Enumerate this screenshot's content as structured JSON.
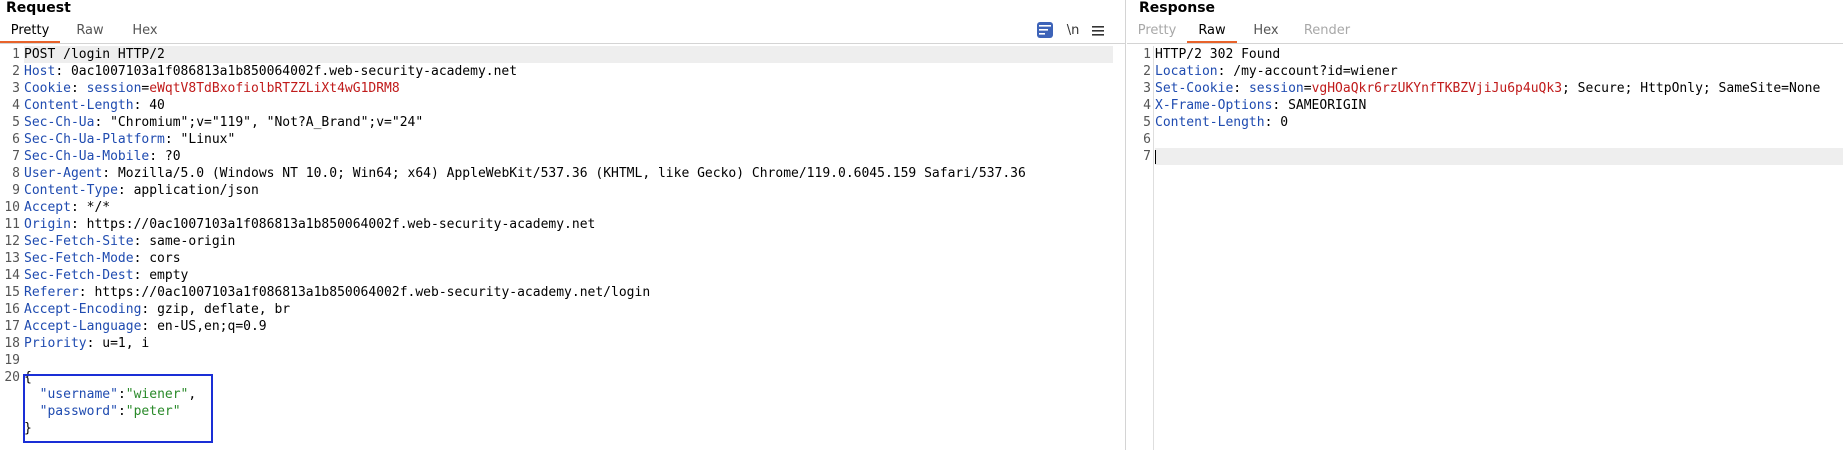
{
  "request": {
    "title": "Request",
    "tabs": [
      "Pretty",
      "Raw",
      "Hex"
    ],
    "active_tab": "Pretty",
    "tools": {
      "wrap_icon": "wrap-lines-icon",
      "newline_label": "\\n",
      "menu_icon": "hamburger-menu-icon"
    },
    "lines": [
      {
        "num": "1",
        "raw": "POST /login HTTP/2"
      },
      {
        "num": "2",
        "key": "Host",
        "value": "0ac1007103a1f086813a1b850064002f.web-security-academy.net"
      },
      {
        "num": "3",
        "key": "Cookie",
        "ckey": "session",
        "cval": "eWqtV8TdBxofiolbRTZZLiXt4wG1DRM8"
      },
      {
        "num": "4",
        "key": "Content-Length",
        "value": "40"
      },
      {
        "num": "5",
        "key": "Sec-Ch-Ua",
        "value": "\"Chromium\";v=\"119\", \"Not?A_Brand\";v=\"24\""
      },
      {
        "num": "6",
        "key": "Sec-Ch-Ua-Platform",
        "value": "\"Linux\""
      },
      {
        "num": "7",
        "key": "Sec-Ch-Ua-Mobile",
        "value": "?0"
      },
      {
        "num": "8",
        "key": "User-Agent",
        "value": "Mozilla/5.0 (Windows NT 10.0; Win64; x64) AppleWebKit/537.36 (KHTML, like Gecko) Chrome/119.0.6045.159 Safari/537.36"
      },
      {
        "num": "9",
        "key": "Content-Type",
        "value": "application/json"
      },
      {
        "num": "10",
        "key": "Accept",
        "value": "*/*"
      },
      {
        "num": "11",
        "key": "Origin",
        "value": "https://0ac1007103a1f086813a1b850064002f.web-security-academy.net"
      },
      {
        "num": "12",
        "key": "Sec-Fetch-Site",
        "value": "same-origin"
      },
      {
        "num": "13",
        "key": "Sec-Fetch-Mode",
        "value": "cors"
      },
      {
        "num": "14",
        "key": "Sec-Fetch-Dest",
        "value": "empty"
      },
      {
        "num": "15",
        "key": "Referer",
        "value": "https://0ac1007103a1f086813a1b850064002f.web-security-academy.net/login"
      },
      {
        "num": "16",
        "key": "Accept-Encoding",
        "value": "gzip, deflate, br"
      },
      {
        "num": "17",
        "key": "Accept-Language",
        "value": "en-US,en;q=0.9"
      },
      {
        "num": "18",
        "key": "Priority",
        "value": "u=1, i"
      },
      {
        "num": "19",
        "raw": ""
      },
      {
        "num": "20",
        "raw": "{"
      },
      {
        "num": "",
        "jkey": "\"username\"",
        "jval": "\"wiener\"",
        "trail": ","
      },
      {
        "num": "",
        "jkey": "\"password\"",
        "jval": "\"peter\"",
        "trail": ""
      },
      {
        "num": "",
        "raw": "}"
      }
    ]
  },
  "response": {
    "title": "Response",
    "tabs": [
      "Pretty",
      "Raw",
      "Hex",
      "Render"
    ],
    "active_tab": "Raw",
    "disabled_tabs": [
      "Pretty",
      "Render"
    ],
    "lines": [
      {
        "num": "1",
        "raw": "HTTP/2 302 Found"
      },
      {
        "num": "2",
        "key": "Location",
        "value": "/my-account?id=wiener"
      },
      {
        "num": "3",
        "key": "Set-Cookie",
        "ckey": "session",
        "cval": "vgHOaQkr6rzUKYnfTKBZVjiJu6p4uQk3",
        "tail": "; Secure; HttpOnly; SameSite=None"
      },
      {
        "num": "4",
        "key": "X-Frame-Options",
        "value": "SAMEORIGIN"
      },
      {
        "num": "5",
        "key": "Content-Length",
        "value": "0"
      },
      {
        "num": "6",
        "raw": ""
      },
      {
        "num": "7",
        "raw": "",
        "caret": true
      }
    ]
  }
}
